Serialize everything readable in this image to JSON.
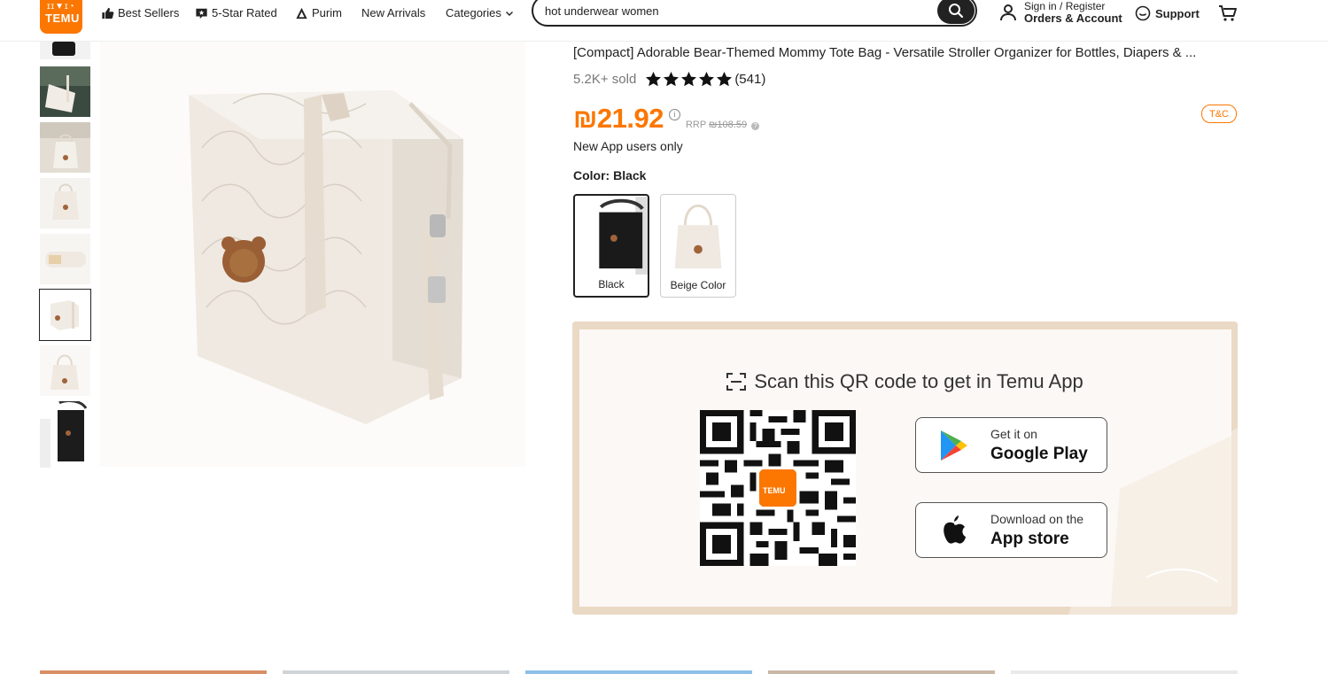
{
  "header": {
    "logo_text": "TEMU",
    "logo_glyphs": "ɪɪ▼ɪ◔",
    "nav": [
      {
        "label": "Best Sellers",
        "icon": "thumbs-up-icon"
      },
      {
        "label": "5-Star Rated",
        "icon": "star-badge-icon"
      },
      {
        "label": "Purim",
        "icon": "mountain-icon"
      },
      {
        "label": "New Arrivals",
        "icon": ""
      },
      {
        "label": "Categories",
        "icon": "chevron-down-icon"
      }
    ],
    "search_value": "hot underwear women",
    "account_line1": "Sign in / Register",
    "account_line2": "Orders & Account",
    "support_label": "Support"
  },
  "product": {
    "title": "[Compact] Adorable Bear-Themed Mommy Tote Bag - Versatile Stroller Organizer for Bottles, Diapers & ...",
    "sold": "5.2K+ sold",
    "rating_stars": 5,
    "reviews": "(541)",
    "price": "₪21.92",
    "rrp_label": "RRP",
    "rrp_price": "₪108.59",
    "tc_label": "T&C",
    "new_app_note": "New App users only",
    "color_label": "Color: Black",
    "swatches": [
      {
        "label": "Black",
        "selected": true
      },
      {
        "label": "Beige Color",
        "selected": false
      }
    ]
  },
  "qr_panel": {
    "title": "Scan this QR code to get in Temu App",
    "google_small": "Get it on",
    "google_big": "Google Play",
    "apple_small": "Download on the",
    "apple_big": "App store",
    "qr_logo": "TEMU"
  },
  "colors": {
    "accent": "#fb7701",
    "text": "#222222",
    "panel_border": "#e9d8c4"
  }
}
